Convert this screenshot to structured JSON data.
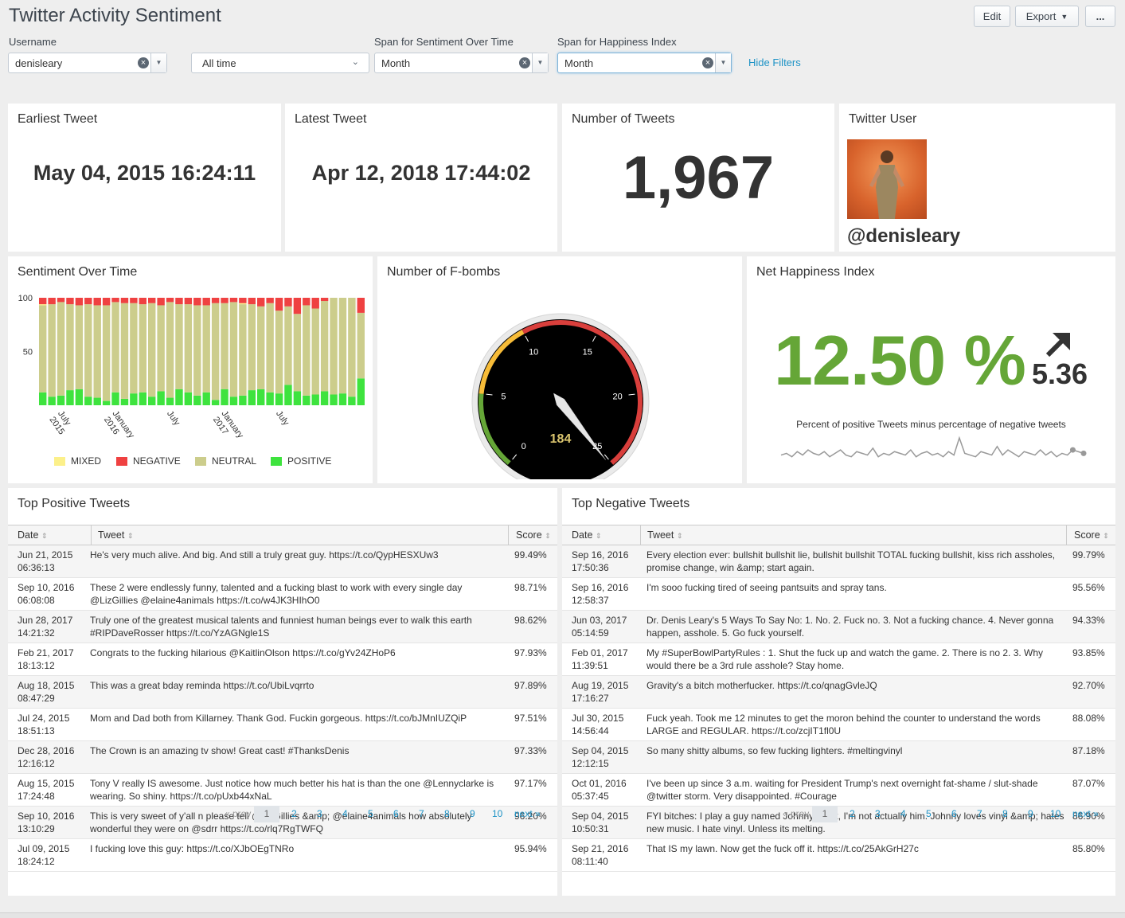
{
  "header": {
    "title": "Twitter Activity Sentiment",
    "edit_label": "Edit",
    "export_label": "Export",
    "more_label": "..."
  },
  "filters": {
    "username": {
      "label": "Username",
      "value": "denisleary"
    },
    "time": {
      "value": "All time"
    },
    "span_sentiment": {
      "label": "Span for Sentiment Over Time",
      "value": "Month"
    },
    "span_happiness": {
      "label": "Span for Happiness Index",
      "value": "Month"
    },
    "hide_filters_label": "Hide Filters"
  },
  "panels": {
    "earliest": {
      "title": "Earliest Tweet",
      "value": "May 04, 2015 16:24:11"
    },
    "latest": {
      "title": "Latest Tweet",
      "value": "Apr 12, 2018 17:44:02"
    },
    "count": {
      "title": "Number of Tweets",
      "value": "1,967"
    },
    "user": {
      "title": "Twitter User",
      "handle": "@denisleary"
    },
    "sentiment": {
      "title": "Sentiment Over Time"
    },
    "fbombs": {
      "title": "Number of F-bombs",
      "value": "184"
    },
    "happiness": {
      "title": "Net Happiness Index",
      "value": "12.50 %",
      "delta": "5.36",
      "caption": "Percent of positive Tweets minus percentage of negative tweets"
    }
  },
  "gauge": {
    "min": 0,
    "max": 25,
    "value": 184,
    "ticks": [
      "0",
      "5",
      "10",
      "15",
      "20",
      "25"
    ],
    "band_colors": [
      "#65a637",
      "#f7bc38",
      "#d93f3c"
    ]
  },
  "sparkline": [
    3,
    4,
    2,
    5,
    3,
    6,
    4,
    3,
    5,
    2,
    4,
    6,
    3,
    2,
    5,
    4,
    3,
    7,
    2,
    4,
    3,
    5,
    4,
    3,
    6,
    2,
    4,
    5,
    3,
    4,
    2,
    5,
    3,
    13,
    4,
    3,
    2,
    5,
    4,
    3,
    8,
    3,
    6,
    4,
    2,
    5,
    4,
    3,
    6,
    3,
    5,
    2,
    4,
    3,
    6,
    5,
    4
  ],
  "chart_data": {
    "type": "bar",
    "stacked": true,
    "title": "Sentiment Over Time",
    "xlabel": "",
    "ylabel": "",
    "ylim": [
      0,
      100
    ],
    "y_ticks": [
      "100",
      "50"
    ],
    "x_tick_labels": [
      {
        "label": "July\n2015",
        "index": 2
      },
      {
        "label": "January\n2016",
        "index": 8
      },
      {
        "label": "July",
        "index": 14
      },
      {
        "label": "January\n2017",
        "index": 20
      },
      {
        "label": "July",
        "index": 26
      }
    ],
    "legend_position": "bottom",
    "categories": [
      "2015-05",
      "2015-06",
      "2015-07",
      "2015-08",
      "2015-09",
      "2015-10",
      "2015-11",
      "2015-12",
      "2016-01",
      "2016-02",
      "2016-03",
      "2016-04",
      "2016-05",
      "2016-06",
      "2016-07",
      "2016-08",
      "2016-09",
      "2016-10",
      "2016-11",
      "2016-12",
      "2017-01",
      "2017-02",
      "2017-03",
      "2017-04",
      "2017-05",
      "2017-06",
      "2017-07",
      "2017-08",
      "2017-09",
      "2017-10",
      "2017-11",
      "2017-12",
      "2018-01",
      "2018-02",
      "2018-03",
      "2018-04"
    ],
    "series": [
      {
        "name": "MIXED",
        "color": "#fcf08a",
        "values": [
          1,
          0,
          0,
          0,
          0,
          0,
          0,
          0,
          0,
          0,
          0,
          0,
          0,
          0,
          0,
          0,
          0,
          0,
          0,
          0,
          0,
          0,
          1,
          0,
          0,
          0,
          0,
          0,
          0,
          0,
          0,
          0,
          0,
          0,
          0,
          0
        ]
      },
      {
        "name": "NEGATIVE",
        "color": "#ef4141",
        "values": [
          6,
          6,
          4,
          6,
          7,
          6,
          7,
          7,
          4,
          5,
          5,
          6,
          5,
          7,
          4,
          6,
          6,
          7,
          7,
          5,
          5,
          4,
          5,
          6,
          8,
          5,
          12,
          8,
          15,
          7,
          10,
          3,
          0,
          0,
          0,
          14
        ]
      },
      {
        "name": "NEUTRAL",
        "color": "#cccd8c",
        "values": [
          81,
          86,
          87,
          80,
          78,
          86,
          86,
          89,
          84,
          89,
          84,
          82,
          87,
          80,
          89,
          79,
          82,
          84,
          81,
          90,
          80,
          88,
          85,
          80,
          77,
          83,
          77,
          73,
          72,
          84,
          80,
          84,
          90,
          89,
          92,
          61
        ]
      },
      {
        "name": "POSITIVE",
        "color": "#3ee33e",
        "values": [
          12,
          8,
          9,
          14,
          15,
          8,
          7,
          4,
          12,
          6,
          11,
          12,
          8,
          13,
          7,
          15,
          12,
          9,
          12,
          5,
          15,
          8,
          9,
          14,
          15,
          12,
          11,
          19,
          13,
          9,
          10,
          13,
          10,
          11,
          8,
          25
        ]
      }
    ]
  },
  "positive_table": {
    "title": "Top Positive Tweets",
    "columns": [
      "Date",
      "Tweet",
      "Score"
    ],
    "rows": [
      {
        "date": "Jun 21, 2015",
        "time": "06:36:13",
        "tweet": "He's very much alive. And big. And still a truly great guy. https://t.co/QypHESXUw3",
        "score": "99.49%"
      },
      {
        "date": "Sep 10, 2016",
        "time": "06:08:08",
        "tweet": "These 2 were endlessly funny, talented and a fucking blast to work with every single day @LizGillies @elaine4animals https://t.co/w4JK3HIhO0",
        "score": "98.71%"
      },
      {
        "date": "Jun 28, 2017",
        "time": "14:21:32",
        "tweet": "Truly one of the greatest musical talents and funniest human beings ever to walk this earth #RIPDaveRosser https://t.co/YzAGNgle1S",
        "score": "98.62%"
      },
      {
        "date": "Feb 21, 2017",
        "time": "18:13:12",
        "tweet": "Congrats to the fucking hilarious @KaitlinOlson https://t.co/gYv24ZHoP6",
        "score": "97.93%"
      },
      {
        "date": "Aug 18, 2015",
        "time": "08:47:29",
        "tweet": "This was a great bday reminda https://t.co/UbiLvqrrto",
        "score": "97.89%"
      },
      {
        "date": "Jul 24, 2015",
        "time": "18:51:13",
        "tweet": "Mom and Dad both from Killarney. Thank God. Fuckin gorgeous. https://t.co/bJMnIUZQiP",
        "score": "97.51%"
      },
      {
        "date": "Dec 28, 2016",
        "time": "12:16:12",
        "tweet": "The Crown is an amazing tv show! Great cast! #ThanksDenis",
        "score": "97.33%"
      },
      {
        "date": "Aug 15, 2015",
        "time": "17:24:48",
        "tweet": "Tony V really IS awesome. Just notice how much better his hat is than the one @Lennyclarke is wearing. So shiny. https://t.co/pUxb44xNaL",
        "score": "97.17%"
      },
      {
        "date": "Sep 10, 2016",
        "time": "13:10:29",
        "tweet": "This is very sweet of y'all n please tell @LizGillies &amp; @elaine4animals how absolutely wonderful they were on @sdrr https://t.co/rlq7RgTWFQ",
        "score": "96.20%"
      },
      {
        "date": "Jul 09, 2015",
        "time": "18:24:12",
        "tweet": "I fucking love this guy: https://t.co/XJbOEgTNRo",
        "score": "95.94%"
      }
    ]
  },
  "negative_table": {
    "title": "Top Negative Tweets",
    "columns": [
      "Date",
      "Tweet",
      "Score"
    ],
    "rows": [
      {
        "date": "Sep 16, 2016",
        "time": "17:50:36",
        "tweet": "Every election ever: bullshit bullshit lie, bullshit bullshit TOTAL fucking bullshit, kiss rich assholes, promise change, win &amp; start again.",
        "score": "99.79%"
      },
      {
        "date": "Sep 16, 2016",
        "time": "12:58:37",
        "tweet": "I'm sooo fucking tired of seeing pantsuits and spray tans.",
        "score": "95.56%"
      },
      {
        "date": "Jun 03, 2017",
        "time": "05:14:59",
        "tweet": "Dr. Denis Leary's 5 Ways To Say No: 1. No. 2. Fuck no. 3. Not a fucking chance. 4. Never gonna happen, asshole. 5. Go fuck yourself.",
        "score": "94.33%"
      },
      {
        "date": "Feb 01, 2017",
        "time": "11:39:51",
        "tweet": "My #SuperBowlPartyRules : 1. Shut the fuck up and watch the game. 2. There is no 2. 3. Why would there be a 3rd rule asshole? Stay home.",
        "score": "93.85%"
      },
      {
        "date": "Aug 19, 2015",
        "time": "17:16:27",
        "tweet": "Gravity's a bitch motherfucker. https://t.co/qnagGvleJQ",
        "score": "92.70%"
      },
      {
        "date": "Jul 30, 2015",
        "time": "14:56:44",
        "tweet": "Fuck yeah. Took me 12 minutes to get the moron behind the counter to understand the words LARGE and REGULAR. https://t.co/zcjIT1fl0U",
        "score": "88.08%"
      },
      {
        "date": "Sep 04, 2015",
        "time": "12:12:15",
        "tweet": "So many shitty albums, so few fucking lighters. #meltingvinyl",
        "score": "87.18%"
      },
      {
        "date": "Oct 01, 2016",
        "time": "05:37:45",
        "tweet": "I've been up since 3 a.m. waiting for President Trump's next overnight fat-shame / slut-shade @twitter storm. Very disappointed. #Courage",
        "score": "87.07%"
      },
      {
        "date": "Sep 04, 2015",
        "time": "10:50:31",
        "tweet": "FYI bitches: I play a guy named Johnny Rock, I'm not actually him. Johnny loves vinyl &amp; hates new music. I hate vinyl. Unless its melting.",
        "score": "86.90%"
      },
      {
        "date": "Sep 21, 2016",
        "time": "08:11:40",
        "tweet": "That IS my lawn. Now get the fuck off it. https://t.co/25AkGrH27c",
        "score": "85.80%"
      }
    ]
  },
  "pager": {
    "prev": "« prev",
    "next": "next »",
    "pages": [
      "1",
      "2",
      "3",
      "4",
      "5",
      "6",
      "7",
      "8",
      "9",
      "10"
    ]
  }
}
